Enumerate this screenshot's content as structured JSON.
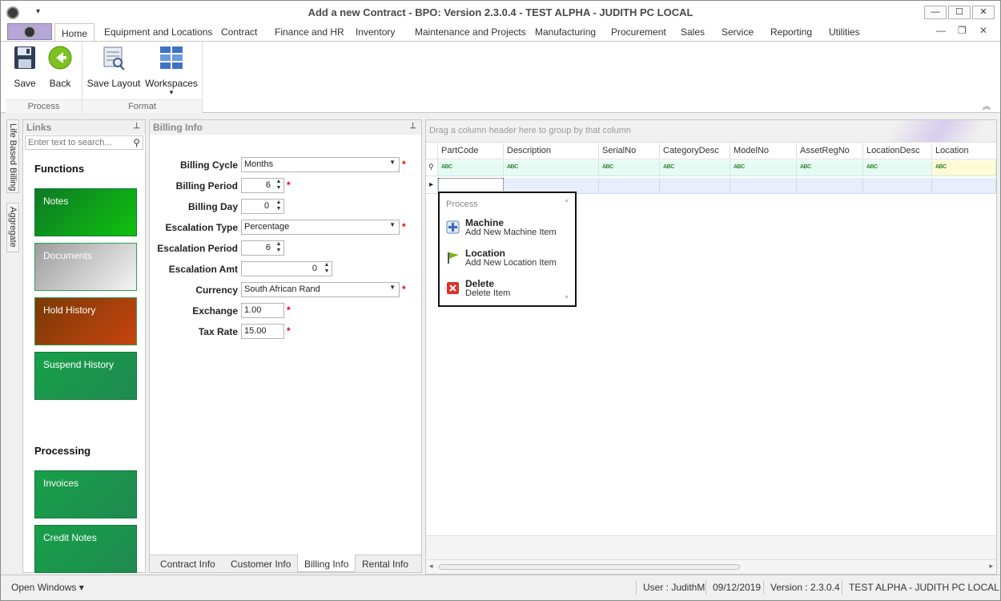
{
  "window": {
    "title_bold": "Add a new Contract",
    "title_rest": " - BPO: Version 2.3.0.4 - TEST ALPHA - JUDITH PC LOCAL",
    "qat_glyph": "▾",
    "minimize": "—",
    "maximize": "☐",
    "close": "✕"
  },
  "ribbon_tabs": [
    "Home",
    "Equipment and Locations",
    "Contract",
    "Finance and HR",
    "Inventory",
    "Maintenance and Projects",
    "Manufacturing",
    "Procurement",
    "Sales",
    "Service",
    "Reporting",
    "Utilities"
  ],
  "mdi": {
    "minimize": "—",
    "restore": "❐",
    "close": "✕"
  },
  "ribbon": {
    "groups": [
      {
        "caption": "Process",
        "buttons": [
          "Save",
          "Back"
        ]
      },
      {
        "caption": "Format",
        "buttons": [
          "Save Layout",
          "Workspaces"
        ]
      }
    ],
    "workspaces_arrow": "▾",
    "collapse_glyph": "︽"
  },
  "side_tabs": [
    "Life Based Billing",
    "Aggregate"
  ],
  "links": {
    "title": "Links",
    "pin": "⊥",
    "search_placeholder": "Enter text to search...",
    "functions_heading": "Functions",
    "functions": [
      "Notes",
      "Documents",
      "Hold History",
      "Suspend History"
    ],
    "processing_heading": "Processing",
    "processing": [
      "Invoices",
      "Credit Notes"
    ]
  },
  "billing": {
    "title": "Billing Info",
    "pin": "⊥",
    "required_mark": "*",
    "fields": {
      "cycle": {
        "label": "Billing Cycle",
        "value": "Months"
      },
      "period": {
        "label": "Billing Period",
        "value": "6"
      },
      "day": {
        "label": "Billing Day",
        "value": "0"
      },
      "esc_type": {
        "label": "Escalation Type",
        "value": "Percentage"
      },
      "esc_period": {
        "label": "Escalation Period",
        "value": "6"
      },
      "esc_amt": {
        "label": "Escalation Amt",
        "value": "0"
      },
      "currency": {
        "label": "Currency",
        "value": "South African Rand"
      },
      "exchange": {
        "label": "Exchange",
        "value": "1.00"
      },
      "tax": {
        "label": "Tax Rate",
        "value": "15.00"
      }
    },
    "tabs": [
      "Contract Info",
      "Customer Info",
      "Billing Info",
      "Rental Info"
    ],
    "active_tab": "Billing Info"
  },
  "grid": {
    "group_hint": "Drag a column header here to group by that column",
    "columns": [
      "PartCode",
      "Description",
      "SerialNo",
      "CategoryDesc",
      "ModelNo",
      "AssetRegNo",
      "LocationDesc",
      "Location"
    ],
    "filter_glyph": "ABC",
    "filter_row_icon": "⚲",
    "row_indicator": "▸",
    "scroll_left": "◂",
    "scroll_right": "▸"
  },
  "context_menu": {
    "caption": "Process",
    "items": [
      {
        "title": "Machine",
        "subtitle": "Add New Machine Item"
      },
      {
        "title": "Location",
        "subtitle": "Add New Location Item"
      },
      {
        "title": "Delete",
        "subtitle": "Delete Item"
      }
    ]
  },
  "status": {
    "open_windows": "Open Windows ▾",
    "user": "User : JudithM",
    "date": "09/12/2019",
    "version": "Version : 2.3.0.4",
    "env": "TEST ALPHA - JUDITH PC LOCAL"
  },
  "colors": {
    "tile_green": "#21a05a",
    "tile_bright_green": "#0fb50f",
    "tile_gray": "#a8a8a8",
    "tile_brown": "#b8460c"
  }
}
